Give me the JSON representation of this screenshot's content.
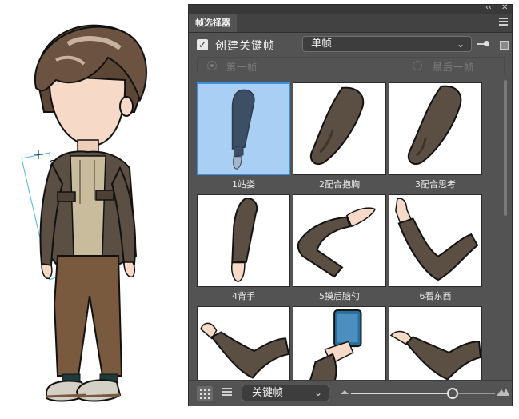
{
  "panel": {
    "title": "帧选择器",
    "collapse_icon": "double-chevron-left-icon",
    "close_icon": "close-icon",
    "menu_icon": "hamburger-menu-icon"
  },
  "options": {
    "create_keyframe_checked": true,
    "create_keyframe_label": "创建关键帧",
    "mode_select_value": "单帧",
    "first_frame_label": "第一帧",
    "last_frame_label": "最后一帧"
  },
  "frames": [
    {
      "label": "1站姿",
      "selected": true
    },
    {
      "label": "2配合抱胸",
      "selected": false
    },
    {
      "label": "3配合思考",
      "selected": false
    },
    {
      "label": "4背手",
      "selected": false
    },
    {
      "label": "5摸后脑勺",
      "selected": false
    },
    {
      "label": "6看东西",
      "selected": false
    },
    {
      "label": "",
      "selected": false
    },
    {
      "label": "",
      "selected": false
    },
    {
      "label": "",
      "selected": false
    }
  ],
  "bottom": {
    "filter_select_value": "关键帧",
    "thumbnail_size_fraction": 0.7
  },
  "colors": {
    "panel_bg": "#535353",
    "selection_blue": "#3a8fe0",
    "sleeve_brown": "#5b4e42"
  }
}
